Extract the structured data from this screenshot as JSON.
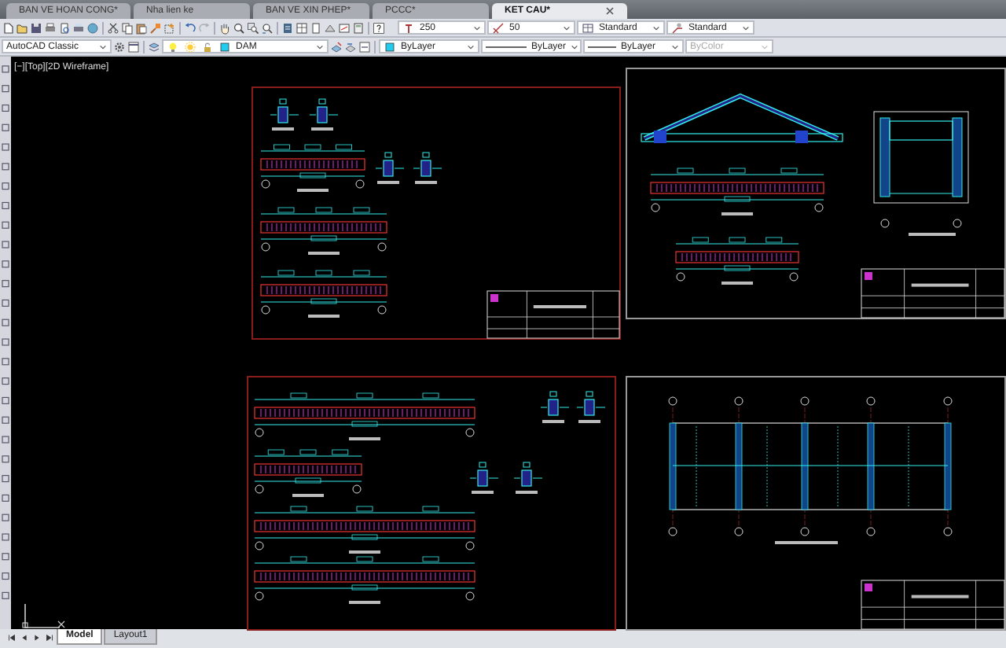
{
  "tabs": [
    {
      "label": "BAN VE HOAN CONG*",
      "selected": false
    },
    {
      "label": "Nha lien ke",
      "selected": false
    },
    {
      "label": "BAN VE XIN PHEP*",
      "selected": false
    },
    {
      "label": "PCCC*",
      "selected": false
    },
    {
      "label": "KET CAU*",
      "selected": true
    }
  ],
  "toolbar_1": {
    "dropdowns": [
      {
        "kind": "text",
        "value": "250"
      },
      {
        "kind": "dim",
        "value": "50"
      },
      {
        "kind": "table",
        "value": "Standard"
      },
      {
        "kind": "multileader",
        "value": "Standard"
      }
    ]
  },
  "toolbar_2": {
    "workspace": "AutoCAD Classic",
    "layer": "DAM",
    "properties": [
      {
        "kind": "color",
        "value": "ByLayer",
        "disabled": false
      },
      {
        "kind": "linetype",
        "value": "ByLayer",
        "disabled": false
      },
      {
        "kind": "lineweight",
        "value": "ByLayer",
        "disabled": false
      },
      {
        "kind": "plotstyle",
        "value": "ByColor",
        "disabled": true
      }
    ]
  },
  "viewport": {
    "label": "[−][Top][2D Wireframe]"
  },
  "layout_tabs": [
    {
      "label": "Model",
      "selected": true
    },
    {
      "label": "Layout1",
      "selected": false
    }
  ]
}
